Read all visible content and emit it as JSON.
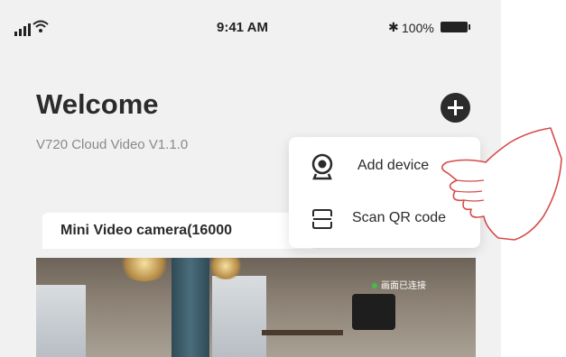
{
  "status_bar": {
    "time": "9:41 AM",
    "battery": "100%",
    "icons": [
      "signal-icon",
      "wifi-icon",
      "bluetooth-icon",
      "battery-icon"
    ]
  },
  "header": {
    "title": "Welcome",
    "subtitle": "V720 Cloud Video V1.1.0",
    "add_button_icon": "plus-circle-icon"
  },
  "dropdown_menu": {
    "items": [
      {
        "label": "Add device",
        "icon": "camera-icon"
      },
      {
        "label": "Scan QR code",
        "icon": "qr-scan-icon"
      }
    ]
  },
  "device_card": {
    "name": "Mini Video camera(16000",
    "live_label": "画面已连接"
  },
  "colors": {
    "background": "#f1f1f1",
    "card": "#ffffff",
    "text_dark": "#2b2b2b",
    "text_muted": "#8a8a8a",
    "live_dot": "#3ec04a"
  }
}
